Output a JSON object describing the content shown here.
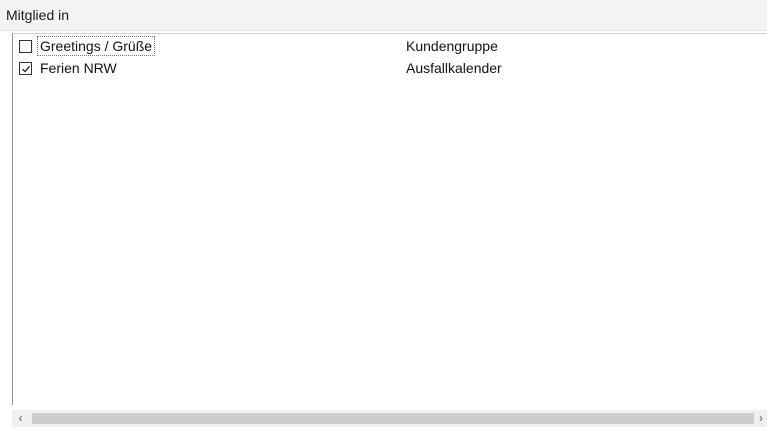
{
  "panel": {
    "title": "Mitglied in"
  },
  "list": {
    "items": [
      {
        "name": "Greetings / Grüße",
        "type": "Kundengruppe",
        "checked": false,
        "focused": true
      },
      {
        "name": "Ferien NRW",
        "type": "Ausfallkalender",
        "checked": true,
        "focused": false
      }
    ]
  },
  "scrollbar": {
    "left_arrow": "‹",
    "right_arrow": "›"
  }
}
